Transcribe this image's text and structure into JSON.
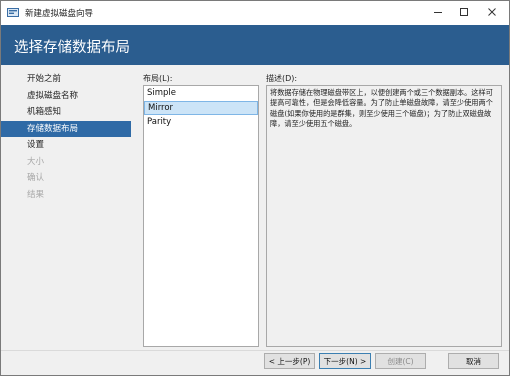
{
  "window": {
    "title": "新建虚拟磁盘向导"
  },
  "header": {
    "title": "选择存储数据布局"
  },
  "nav": {
    "items": [
      {
        "label": "开始之前",
        "state": "normal"
      },
      {
        "label": "虚拟磁盘名称",
        "state": "normal"
      },
      {
        "label": "机箱感知",
        "state": "normal"
      },
      {
        "label": "存储数据布局",
        "state": "active"
      },
      {
        "label": "设置",
        "state": "normal"
      },
      {
        "label": "大小",
        "state": "disabled"
      },
      {
        "label": "确认",
        "state": "disabled"
      },
      {
        "label": "结果",
        "state": "disabled"
      }
    ]
  },
  "layout": {
    "label": "布局(L):",
    "options": [
      "Simple",
      "Mirror",
      "Parity"
    ],
    "selected": "Mirror"
  },
  "description": {
    "label": "描述(D):",
    "text": "将数据存储在物理磁盘带区上，以便创建两个或三个数据副本。这样可提高可靠性，但是会降低容量。为了防止单磁盘故障，请至少使用两个磁盘(如果你使用的是群集，则至少使用三个磁盘)；为了防止双磁盘故障，请至少使用五个磁盘。"
  },
  "buttons": {
    "prev": "< 上一步(P)",
    "next": "下一步(N) >",
    "create": "创建(C)",
    "cancel": "取消"
  },
  "colors": {
    "header_bg": "#2b5d8f",
    "nav_active_bg": "#2f6aa6",
    "selection_bg": "#cce4f7"
  }
}
